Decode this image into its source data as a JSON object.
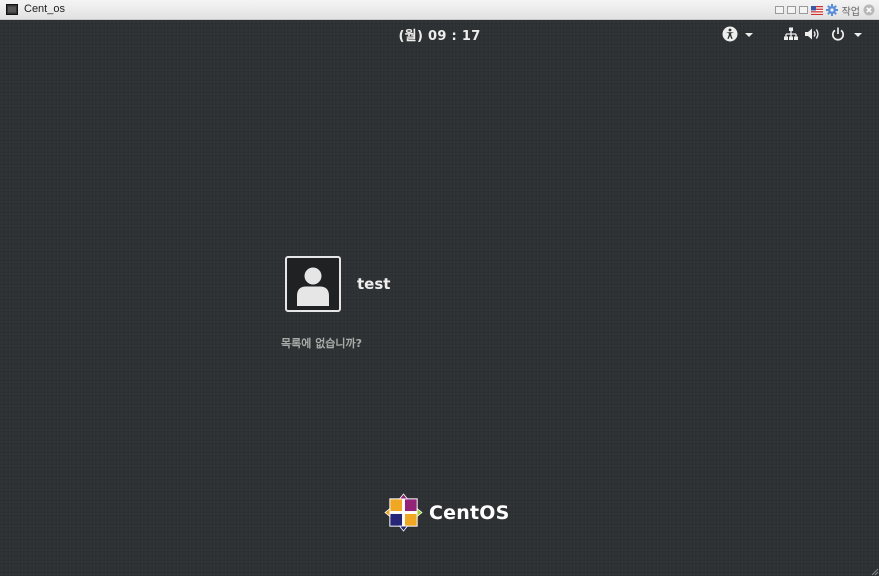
{
  "window": {
    "title": "Cent_os",
    "mode_label": "작업"
  },
  "topbar": {
    "clock": "(월) 09 : 17"
  },
  "icons": {
    "app": "terminal-window-icon",
    "accessibility": "accessibility-icon",
    "network": "network-wired-icon",
    "volume": "volume-icon",
    "power": "power-icon"
  },
  "login": {
    "username": "test",
    "not_listed": "목록에 없습니까?"
  },
  "brand": {
    "name": "CentOS"
  }
}
